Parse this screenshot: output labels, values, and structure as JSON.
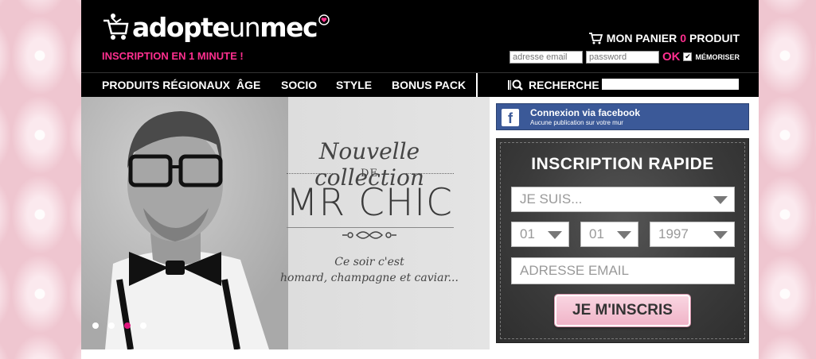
{
  "brand": {
    "logo_part1": "adopte",
    "logo_part2": "un",
    "logo_part3": "mec",
    "tagline": "INSCRIPTION EN 1 MINUTE !"
  },
  "cart": {
    "label_before": "MON PANIER",
    "count": "0",
    "label_after": "PRODUIT"
  },
  "login": {
    "email_placeholder": "adresse email",
    "password_placeholder": "password",
    "ok_label": "OK",
    "remember_label": "MÉMORISER",
    "remember_checked": true
  },
  "nav": {
    "items": [
      "PRODUITS RÉGIONAUX",
      "ÂGE",
      "SOCIO",
      "STYLE",
      "BONUS PACK"
    ],
    "search_label": "RECHERCHE"
  },
  "hero": {
    "script_line": "Nouvelle collection",
    "de": "DE",
    "name": "MR CHIC",
    "subtitle_line1": "Ce soir c'est",
    "subtitle_line2": "homard, champagne et caviar...",
    "dots": 4,
    "active_dot": 2
  },
  "facebook": {
    "icon": "f",
    "title": "Connexion via facebook",
    "subtitle": "Aucune publication sur votre mur"
  },
  "signup": {
    "title": "INSCRIPTION RAPIDE",
    "gender_value": "JE SUIS...",
    "day_value": "01",
    "month_value": "01",
    "year_value": "1997",
    "email_placeholder": "ADRESSE EMAIL",
    "submit_label": "JE M'INSCRIS"
  },
  "colors": {
    "accent_pink": "#ff2f8f",
    "active_dot": "#e0157d",
    "facebook_blue": "#3b5998",
    "header_bg": "#000000"
  }
}
